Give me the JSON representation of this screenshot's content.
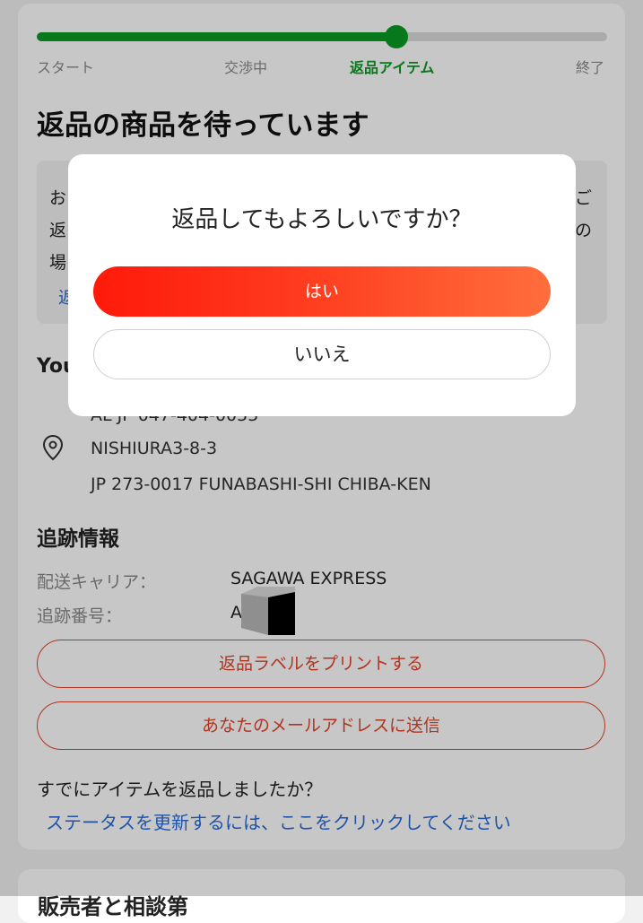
{
  "progress": {
    "value_percent": 63,
    "steps": [
      "スタート",
      "交渉中",
      "返品アイテム",
      "終了"
    ],
    "active_step": 2
  },
  "page_title": "返品の商品を待っています",
  "notice": {
    "line_starts": [
      "お",
      "返",
      "場"
    ],
    "line_ends": [
      "ご",
      "の"
    ],
    "link_start": "返"
  },
  "address": {
    "heading_partial": "You",
    "phone_partial": "AL JP 047-404-0055",
    "street": "NISHIURA3-8-3",
    "city": "JP 273-0017 FUNABASHI-SHI CHIBA-KEN"
  },
  "tracking": {
    "heading": "追跡情報",
    "carrier_label": "配送キャリア：",
    "carrier_value": "SAGAWA EXPRESS",
    "number_label": "追跡番号：",
    "number_value_partial": "A"
  },
  "actions": {
    "print_label": "返品ラベルをプリントする",
    "email_label": "あなたのメールアドレスに送信"
  },
  "returned_question": "すでにアイテムを返品しましたか？",
  "update_status_link": "ステータスを更新するには、ここをクリックしてください",
  "next_card_title": "販売者と相談第",
  "dialog": {
    "message": "返品してもよろしいですか？",
    "yes_label": "はい",
    "no_label": "いいえ"
  },
  "colors": {
    "progress_green": "#0a9a25",
    "accent_red": "#e2452b",
    "link_blue": "#2a6bd8"
  }
}
